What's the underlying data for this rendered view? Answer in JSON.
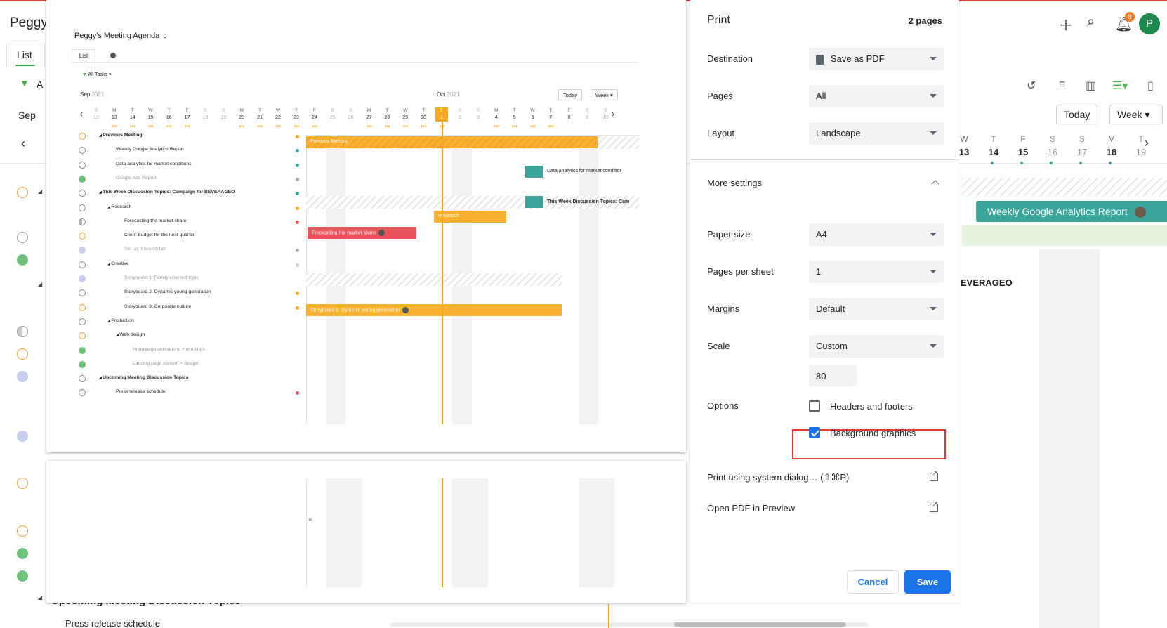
{
  "background_app": {
    "title": "Peggy",
    "tab": "List",
    "filter_initial": "A",
    "month": "Sep",
    "toolbar": {
      "today": "Today",
      "week": "Week",
      "notification_count": "8",
      "avatar_initial": "P"
    },
    "days": [
      {
        "dow": "W",
        "num": "13"
      },
      {
        "dow": "T",
        "num": "14"
      },
      {
        "dow": "F",
        "num": "15"
      },
      {
        "dow": "S",
        "num": "16"
      },
      {
        "dow": "S",
        "num": "17"
      },
      {
        "dow": "M",
        "num": "18"
      },
      {
        "dow": "T",
        "num": "19"
      }
    ],
    "bar_label": "Weekly Google Analytics Report",
    "beverageo_fragment": "EVERAGEO",
    "bottom_heading": "Upcoming Meeting Discussion Topics",
    "bottom_item": "Press release schedule"
  },
  "preview": {
    "project_title": "Peggy's Meeting Agenda",
    "tab": "List",
    "filter": "All Tasks",
    "month_sep": "Sep",
    "month_sep_year": "2021",
    "month_oct": "Oct",
    "month_oct_year": "2021",
    "today": "Today",
    "week": "Week",
    "days": [
      {
        "d": "S",
        "n": "12"
      },
      {
        "d": "M",
        "n": "13"
      },
      {
        "d": "T",
        "n": "14"
      },
      {
        "d": "W",
        "n": "15"
      },
      {
        "d": "T",
        "n": "16"
      },
      {
        "d": "F",
        "n": "17"
      },
      {
        "d": "S",
        "n": "18"
      },
      {
        "d": "S",
        "n": "19"
      },
      {
        "d": "M",
        "n": "20"
      },
      {
        "d": "T",
        "n": "21"
      },
      {
        "d": "W",
        "n": "22"
      },
      {
        "d": "T",
        "n": "23"
      },
      {
        "d": "F",
        "n": "24"
      },
      {
        "d": "S",
        "n": "25"
      },
      {
        "d": "S",
        "n": "26"
      },
      {
        "d": "M",
        "n": "27"
      },
      {
        "d": "T",
        "n": "28"
      },
      {
        "d": "W",
        "n": "29"
      },
      {
        "d": "T",
        "n": "30"
      },
      {
        "d": "F",
        "n": "1"
      },
      {
        "d": "S",
        "n": "2"
      },
      {
        "d": "S",
        "n": "3"
      },
      {
        "d": "M",
        "n": "4"
      },
      {
        "d": "T",
        "n": "5"
      },
      {
        "d": "W",
        "n": "6"
      },
      {
        "d": "T",
        "n": "7"
      },
      {
        "d": "F",
        "n": "8"
      },
      {
        "d": "S",
        "n": "9"
      },
      {
        "d": "S",
        "n": "10"
      }
    ],
    "tasks": [
      "Previous Meeting",
      "Weekly Google Analytics Report",
      "Data analytics for market conditions",
      "Google Ads Report",
      "This Week Discussion Topics: Campaign for BEVERAGEO",
      "Research",
      "Forecasting the market share",
      "Client Budget for the next quarter",
      "Set up research lab",
      "Creative",
      "Storyboard 1: Family-oriented topic",
      "Storyboard 2: Dynamic young generation",
      "Storyboard 3: Corporate culture",
      "Production",
      "Web design",
      "Homepage animations + wordings",
      "Landing page content + design",
      "Upcoming Meeting Discussion Topics",
      "Press release schedule"
    ],
    "bars": {
      "previous_meeting": "Previous Meeting",
      "data_analytics": "Data analytics for market conditior",
      "this_week": "This Week Discussion Topics: Cam",
      "research": "Research",
      "forecasting": "Forecasting the market share",
      "storyboard2": "Storyboard 2: Dynamic young generation"
    },
    "page2_collapse": "«"
  },
  "dialog": {
    "title": "Print",
    "page_count": "2 pages",
    "destination_label": "Destination",
    "destination_value": "Save as PDF",
    "pages_label": "Pages",
    "pages_value": "All",
    "layout_label": "Layout",
    "layout_value": "Landscape",
    "more_settings": "More settings",
    "paper_size_label": "Paper size",
    "paper_size_value": "A4",
    "pages_per_sheet_label": "Pages per sheet",
    "pages_per_sheet_value": "1",
    "margins_label": "Margins",
    "margins_value": "Default",
    "scale_label": "Scale",
    "scale_value": "Custom",
    "scale_custom": "80",
    "options_label": "Options",
    "headers_footers": "Headers and footers",
    "headers_footers_checked": false,
    "background_graphics": "Background graphics",
    "background_graphics_checked": true,
    "system_dialog": "Print using system dialog… (⇧⌘P)",
    "open_pdf": "Open PDF in Preview",
    "cancel": "Cancel",
    "save": "Save",
    "accent": "#1a73e8",
    "highlight_color": "#e53935"
  }
}
